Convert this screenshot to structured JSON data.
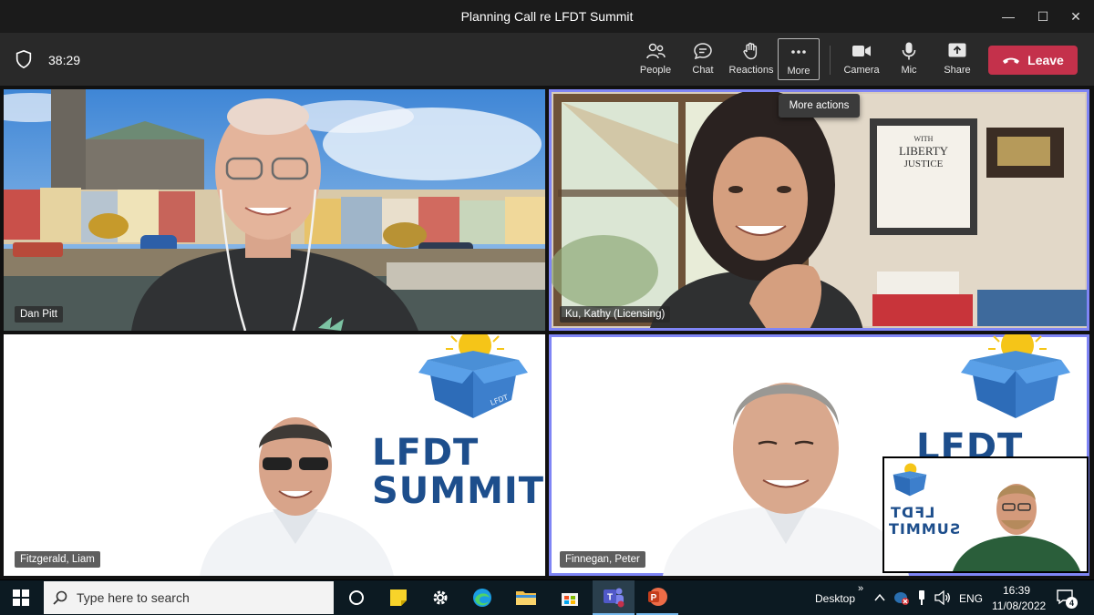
{
  "window": {
    "title": "Planning Call re LFDT Summit",
    "minimize_glyph": "—",
    "maximize_glyph": "☐",
    "close_glyph": "✕"
  },
  "toolbar": {
    "timer": "38:29",
    "people_label": "People",
    "chat_label": "Chat",
    "reactions_label": "Reactions",
    "more_label": "More",
    "camera_label": "Camera",
    "mic_label": "Mic",
    "share_label": "Share",
    "leave_label": "Leave",
    "tooltip": "More actions"
  },
  "participants": [
    {
      "name": "Dan Pitt"
    },
    {
      "name": "Ku, Kathy (Licensing)"
    },
    {
      "name": "Fitzgerald, Liam"
    },
    {
      "name": "Finnegan, Peter"
    }
  ],
  "branding": {
    "line1": "LFDT",
    "line2": "SUMMIT",
    "box_label": "LFDT"
  },
  "poster": {
    "line1": "WITH",
    "line2": "LIBERTY",
    "line3": "JUSTICE"
  },
  "taskbar": {
    "search_placeholder": "Type here to search",
    "desktop_label": "Desktop",
    "chevrons": "»",
    "language": "ENG",
    "time": "16:39",
    "date": "11/08/2022",
    "notification_count": "4"
  },
  "colors": {
    "leave": "#c4314b",
    "speaking_outline": "#7f85f5",
    "lfdt_blue": "#1d4e8c",
    "sun": "#f5c518"
  }
}
